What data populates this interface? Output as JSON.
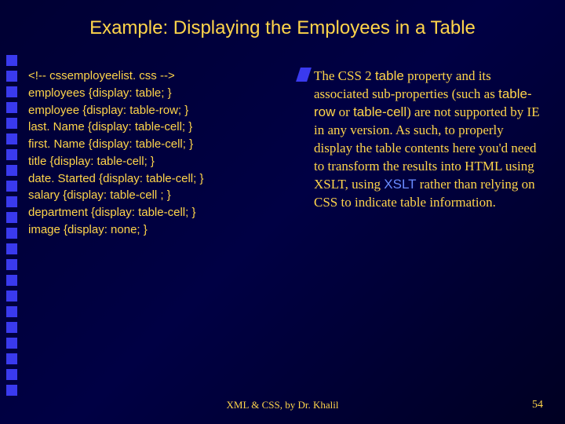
{
  "title": "Example: Displaying the Employees in a Table",
  "code": {
    "l0": "<!-- cssemployeelist. css -->",
    "l1": "employees {display: table; }",
    "l2": "employee {display: table-row; }",
    "l3": "last. Name {display: table-cell; }",
    "l4": "first. Name {display: table-cell; }",
    "l5": "title {display: table-cell; }",
    "l6": "date. Started {display: table-cell; }",
    "l7": "salary {display: table-cell ; }",
    "l8": "department {display: table-cell; }",
    "l9": "image {display: none; }"
  },
  "body": {
    "p1a": "The CSS 2 ",
    "p1b": "table",
    "p1c": " property and its associated sub-properties (such as ",
    "p1d": "table-row",
    "p1e": " or ",
    "p1f": "table-cell",
    "p1g": ") are not supported by IE in any version. As such, to properly display the table contents here you'd need to transform the results into HTML using XSLT, using ",
    "p1h": "XSLT",
    "p1i": " rather than relying on CSS to indicate table information."
  },
  "footer": {
    "center": "XML & CSS, by Dr. Khalil",
    "page": "54"
  }
}
